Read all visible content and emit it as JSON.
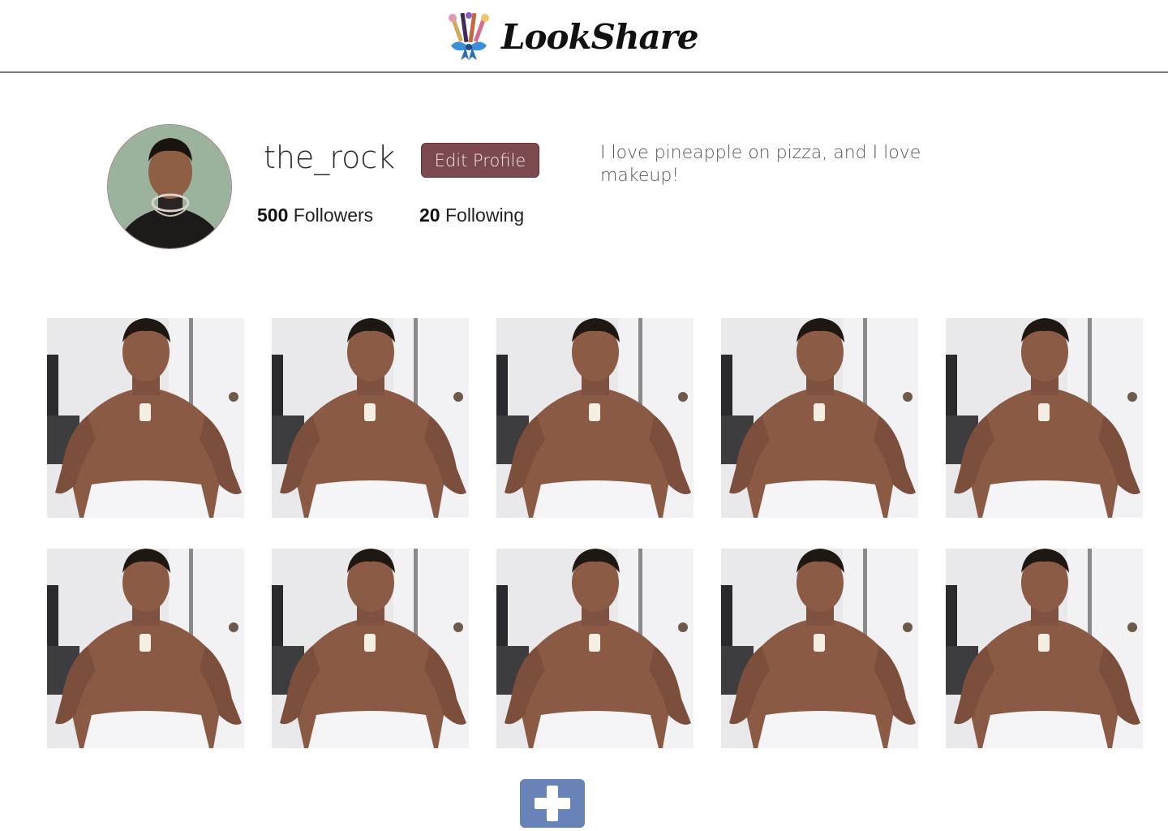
{
  "header": {
    "logo_icon": "makeup-brushes-bow-icon",
    "brand": "LookShare"
  },
  "profile": {
    "avatar_icon": "profile-avatar",
    "username": "the_rock",
    "edit_button_label": "Edit Profile",
    "followers_count": "500",
    "followers_label": "Followers",
    "following_count": "20",
    "following_label": "Following",
    "bio": "I love pineapple on pizza, and I love makeup!",
    "accent_color": "#7b4a4e"
  },
  "posts": {
    "count": 10,
    "rows": 2,
    "columns": 5
  },
  "add_post": {
    "icon": "plus-icon",
    "color": "#6783b7"
  }
}
